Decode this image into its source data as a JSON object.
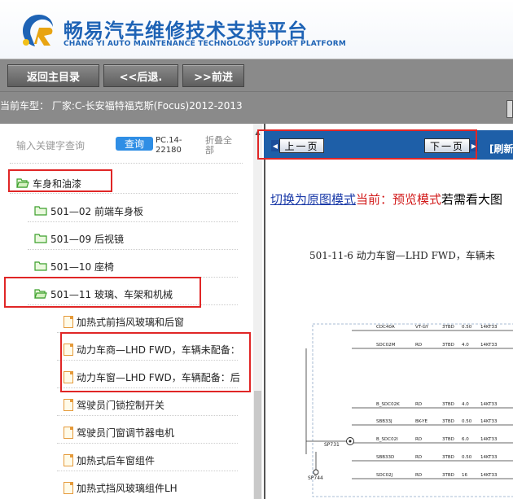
{
  "header": {
    "title": "畅易汽车维修技术支持平台",
    "subtitle": "CHANG YI AUTO MAINTENANCE TECHNOLOGY SUPPORT PLATFORM"
  },
  "nav": {
    "home": "返回主目录",
    "back": "<<后退.",
    "forward": ">>前进"
  },
  "vehicle": {
    "label": "当前车型： 厂家:C-长安福特福克斯(Focus)2012-2013"
  },
  "search": {
    "placeholder": "输入关键字查询",
    "button": "查询",
    "code": "PC.14-22180",
    "collapse": "折叠全部"
  },
  "tree": {
    "root": "车身和油漆",
    "folders": [
      "501—02 前端车身板",
      "501—09 后视镜",
      "501—10 座椅",
      "501—11 玻璃、车架和机械"
    ],
    "docs": [
      "加热式前挡风玻璃和后窗",
      "动力车商—LHD FWD，车辆未配备：",
      "动力车窗—LHD FWD，车辆配备：后",
      "驾驶员门锁控制开关",
      "驾驶员门窗调节器电机",
      "加热式后车窗组件",
      "加热式挡风玻璃组件LH"
    ]
  },
  "pager": {
    "prev": "上一页",
    "next": "下一页",
    "refresh": "[刷新"
  },
  "mode": {
    "switch_link": "切换为原图模式",
    "current": "当前：预览模式",
    "tail": "若需看大图"
  },
  "diagram": {
    "title": "501-11-6 动力车窗—LHD FWD，车辆未",
    "rows": [
      [
        "CDC40A",
        "VT-GY",
        "3TBD",
        "0.50",
        "14KT33"
      ],
      [
        "SDC02M",
        "RD",
        "3TBD",
        "4.0",
        "14KT33"
      ],
      [
        "B_SDC02K",
        "RD",
        "3TBD",
        "4.0",
        "14KT33"
      ],
      [
        "SBB33J",
        "BK-YE",
        "3TBD",
        "0.50",
        "14KT33"
      ],
      [
        "B_SDC02I",
        "RD",
        "3TBD",
        "6.0",
        "14KT33"
      ],
      [
        "SBB33D",
        "RD",
        "3TBD",
        "0.50",
        "14KT33"
      ],
      [
        "SDC02J",
        "RD",
        "3TBD",
        "16",
        "14KT33"
      ]
    ],
    "splices": [
      "SP731",
      "SP744"
    ]
  },
  "colors": {
    "brand_blue": "#1e63b5",
    "nav_gray": "#8a8a8a",
    "pager_blue": "#1e5fa8",
    "highlight_red": "#e02626",
    "link_blue": "#1a3aa8",
    "current_red": "#d21b1b"
  }
}
